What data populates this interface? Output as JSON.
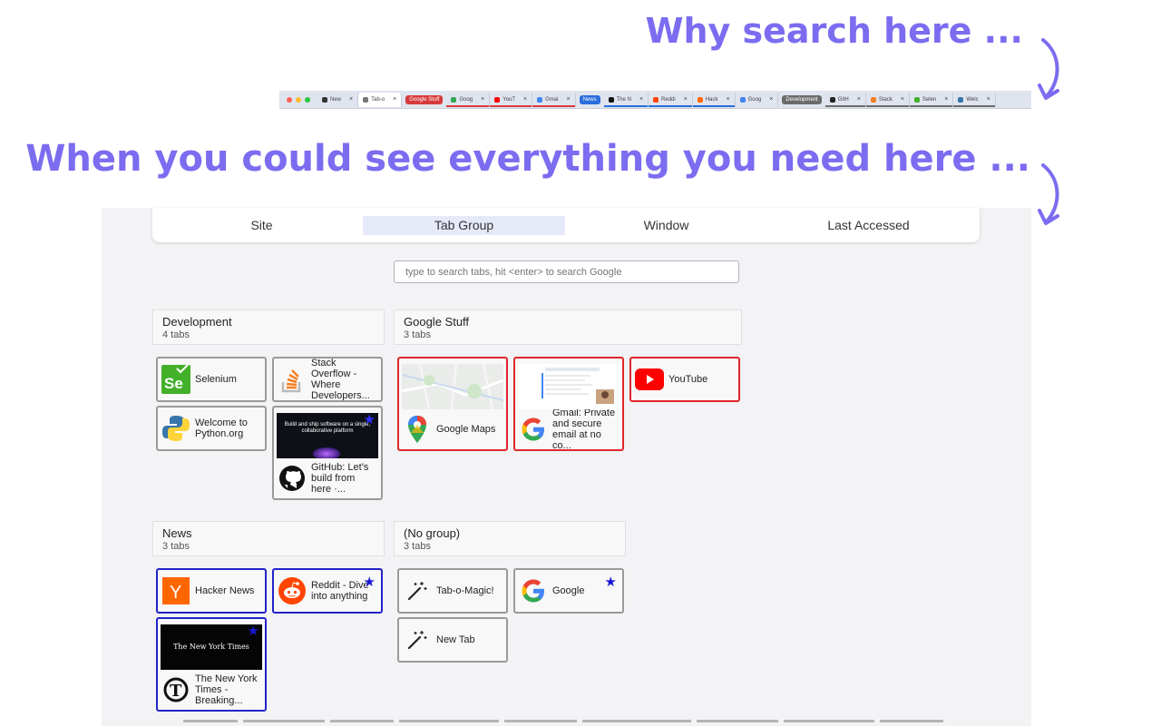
{
  "headline_top": "Why search here ...",
  "headline_bottom": "When you could see everything you need here ...",
  "accent_color": "#7b6cf0",
  "tab_strip": {
    "tabs": [
      {
        "label": "New",
        "icon": "openai-icon",
        "underline": ""
      },
      {
        "label": "Tab-o",
        "icon": "magic-wand-icon",
        "underline": "",
        "active": true
      },
      {
        "group": "Google Stuff",
        "color": "#d63b3b"
      },
      {
        "label": "Goog",
        "icon": "maps-pin-icon",
        "underline": "red"
      },
      {
        "label": "YouT",
        "icon": "youtube-icon",
        "underline": "red"
      },
      {
        "label": "Gmai",
        "icon": "google-icon",
        "underline": "red"
      },
      {
        "group": "News",
        "color": "#2a6ddc"
      },
      {
        "label": "The N",
        "icon": "nyt-icon",
        "underline": "blue"
      },
      {
        "label": "Reddi",
        "icon": "reddit-icon",
        "underline": "blue"
      },
      {
        "label": "Hack",
        "icon": "hn-icon",
        "underline": "blue"
      },
      {
        "label": "Goog",
        "icon": "google-icon",
        "underline": ""
      },
      {
        "group": "Development",
        "color": "#6b6b6b"
      },
      {
        "label": "GitH",
        "icon": "github-icon",
        "underline": "gray"
      },
      {
        "label": "Stack",
        "icon": "stackoverflow-icon",
        "underline": "gray"
      },
      {
        "label": "Selen",
        "icon": "selenium-icon",
        "underline": "gray"
      },
      {
        "label": "Welc",
        "icon": "python-icon",
        "underline": "gray"
      }
    ]
  },
  "view_tabs": [
    {
      "label": "Site",
      "active": false
    },
    {
      "label": "Tab Group",
      "active": true
    },
    {
      "label": "Window",
      "active": false
    },
    {
      "label": "Last Accessed",
      "active": false
    }
  ],
  "search": {
    "placeholder": "type to search tabs, hit <enter> to search Google",
    "value": ""
  },
  "groups": {
    "development": {
      "title": "Development",
      "count": "4 tabs"
    },
    "google": {
      "title": "Google Stuff",
      "count": "3 tabs"
    },
    "news": {
      "title": "News",
      "count": "3 tabs"
    },
    "nogroup": {
      "title": "(No group)",
      "count": "3 tabs"
    }
  },
  "cards": {
    "selenium": {
      "title": "Selenium",
      "icon": "selenium-icon",
      "starred": false
    },
    "stackoverflow": {
      "title": "Stack Overflow - Where Developers...",
      "icon": "stackoverflow-icon",
      "starred": false
    },
    "python": {
      "title": "Welcome to Python.org",
      "icon": "python-icon",
      "starred": false
    },
    "github": {
      "title": "GitHub: Let’s build from here ·...",
      "icon": "github-icon",
      "starred": true,
      "thumb_caption": "Build and ship software on a single, collaborative platform"
    },
    "maps": {
      "title": "Google Maps",
      "icon": "maps-pin-icon",
      "starred": false
    },
    "gmail": {
      "title": "Gmail: Private and secure email at no co...",
      "icon": "google-icon",
      "starred": false
    },
    "youtube": {
      "title": "YouTube",
      "icon": "youtube-icon",
      "starred": false
    },
    "hackernews": {
      "title": "Hacker News",
      "icon": "hn-icon",
      "starred": false
    },
    "reddit": {
      "title": "Reddit - Dive into anything",
      "icon": "reddit-icon",
      "starred": true
    },
    "nyt": {
      "title": "The New York Times - Breaking...",
      "icon": "nyt-icon",
      "starred": true,
      "thumb_caption": "The New York Times"
    },
    "tabomagic": {
      "title": "Tab-o-Magic!",
      "icon": "magic-wand-icon",
      "starred": false
    },
    "google": {
      "title": "Google",
      "icon": "google-icon",
      "starred": true
    },
    "newtab": {
      "title": "New Tab",
      "icon": "magic-wand-icon",
      "starred": false
    }
  },
  "colors": {
    "group_red": "#e0262a",
    "group_blue": "#2323c8",
    "group_gray": "#9a9a9a",
    "star": "#1717d6"
  }
}
